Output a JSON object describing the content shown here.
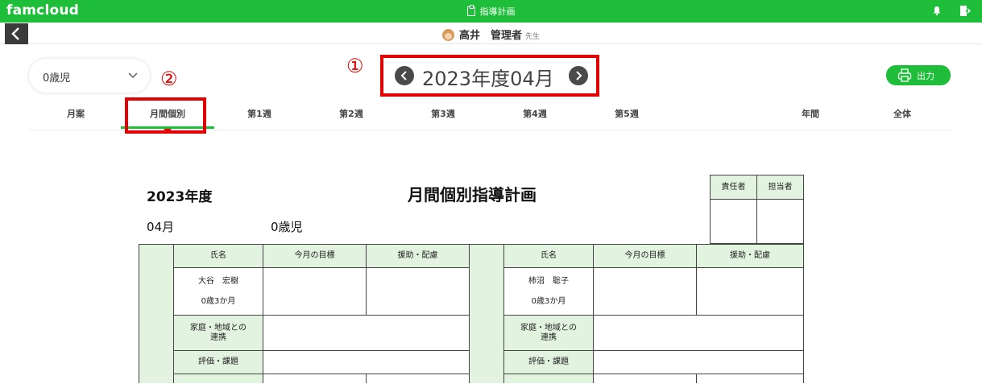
{
  "header": {
    "brand": "famcloud",
    "app_title": "指導計画"
  },
  "user": {
    "name": "高井　管理者",
    "suffix": "先生"
  },
  "toolbar": {
    "age_select_value": "0歳児",
    "month_label": "2023年度04月",
    "print_label": "出力"
  },
  "annotations": {
    "one": "①",
    "two": "②"
  },
  "tabs": [
    {
      "label": "月案"
    },
    {
      "label": "月間個別"
    },
    {
      "label": "第1週"
    },
    {
      "label": "第2週"
    },
    {
      "label": "第3週"
    },
    {
      "label": "第4週"
    },
    {
      "label": "第5週"
    },
    {
      "label": "年間"
    },
    {
      "label": "全体"
    }
  ],
  "active_tab": "月間個別",
  "document": {
    "year": "2023年度",
    "title": "月間個別指導計画",
    "month": "04月",
    "age_class": "0歳児",
    "sign_headers": [
      "責任者",
      "担当者"
    ],
    "columns": [
      "氏名",
      "今月の目標",
      "援助・配慮"
    ],
    "row_labels": {
      "family": "家庭・地域との\n連携",
      "evaluation": "評価・課題"
    },
    "children": [
      {
        "name": "大谷　宏樹",
        "age": "0歳3か月"
      },
      {
        "name": "柿沼　聡子",
        "age": "0歳3か月"
      }
    ]
  },
  "colors": {
    "brand_green": "#1fbe3a",
    "highlight_red": "#e30000",
    "table_header_green": "#e2f4df"
  }
}
